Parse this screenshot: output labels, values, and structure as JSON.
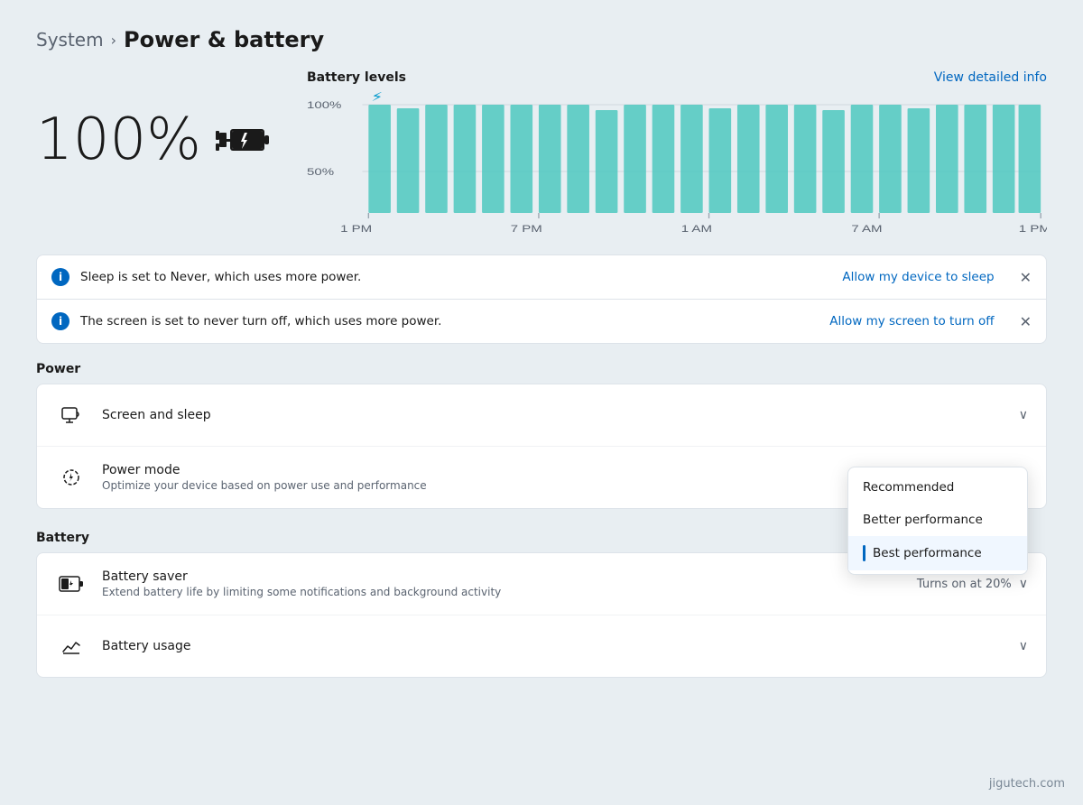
{
  "breadcrumb": {
    "system_label": "System",
    "chevron": "›",
    "current_label": "Power & battery"
  },
  "battery": {
    "percentage": "100%",
    "icon_alt": "battery-charging-icon"
  },
  "chart": {
    "title": "Battery levels",
    "view_link": "View detailed info",
    "y_labels": [
      "100%",
      "50%"
    ],
    "x_labels": [
      "1 PM",
      "7 PM",
      "1 AM",
      "7 AM",
      "1 PM"
    ],
    "bar_color": "#4dc8c0",
    "charge_icon_color": "#0099cc"
  },
  "notifications": [
    {
      "text": "Sleep is set to Never, which uses more power.",
      "action": "Allow my device to sleep"
    },
    {
      "text": "The screen is set to never turn off, which uses more power.",
      "action": "Allow my screen to turn off"
    }
  ],
  "power_section": {
    "label": "Power",
    "rows": [
      {
        "icon": "screen-sleep",
        "title": "Screen and sleep",
        "subtitle": ""
      },
      {
        "icon": "power-mode",
        "title": "Power mode",
        "subtitle": "Optimize your device based on power use and performance"
      }
    ],
    "dropdown": {
      "options": [
        "Recommended",
        "Better performance",
        "Best performance"
      ],
      "selected": "Best performance"
    }
  },
  "battery_section": {
    "label": "Battery",
    "rows": [
      {
        "icon": "battery-saver",
        "title": "Battery saver",
        "subtitle": "Extend battery life by limiting some notifications and background activity",
        "right_text": "Turns on at 20%"
      },
      {
        "icon": "battery-usage",
        "title": "Battery usage",
        "subtitle": "",
        "right_text": ""
      }
    ]
  },
  "watermark": "jigutech.com"
}
